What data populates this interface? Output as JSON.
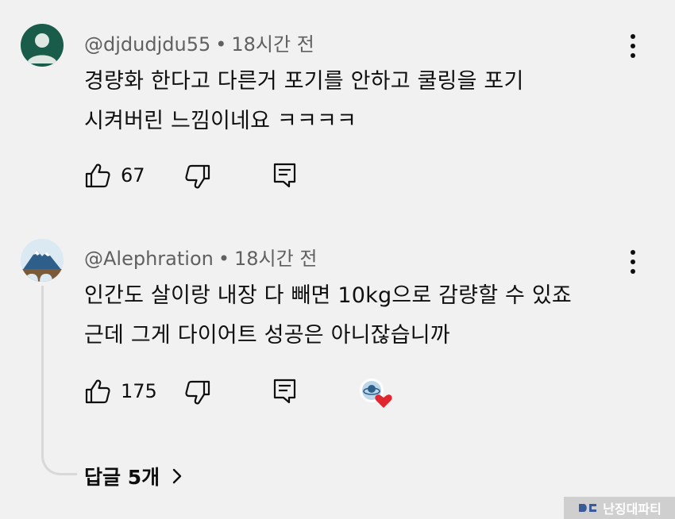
{
  "comments": [
    {
      "username": "@djdudjdu55",
      "separator": "•",
      "time": "18시간 전",
      "lines": [
        "경량화 한다고 다른거 포기를 안하고 쿨링을 포기",
        "시켜버린 느낌이네요 ㅋㅋㅋㅋ"
      ],
      "likes": "67",
      "avatar_color": "#1a5c4a"
    },
    {
      "username": "@Alephration",
      "separator": "•",
      "time": "18시간 전",
      "lines": [
        "인간도 살이랑 내장 다 빼면 10kg으로 감량할 수 있죠",
        "근데 그게 다이어트 성공은 아니잖습니까"
      ],
      "likes": "175",
      "replies_label": "답글 5개"
    }
  ],
  "watermark": "난징대파티",
  "colors": {
    "background": "#f1f1f1",
    "secondary_text": "#606060",
    "heart": "#e0262f"
  }
}
